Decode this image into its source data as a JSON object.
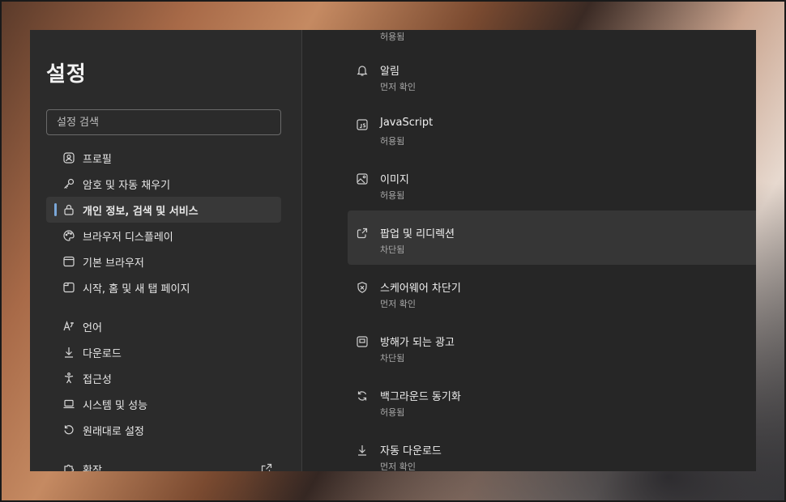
{
  "sidebar": {
    "title": "설정",
    "search_placeholder": "설정 검색",
    "items": [
      {
        "label": "프로필",
        "icon": "profile-icon"
      },
      {
        "label": "암호 및 자동 채우기",
        "icon": "key-icon"
      },
      {
        "label": "개인 정보, 검색 및 서비스",
        "icon": "lock-icon",
        "active": true
      },
      {
        "label": "브라우저 디스플레이",
        "icon": "palette-icon"
      },
      {
        "label": "기본 브라우저",
        "icon": "browser-icon"
      },
      {
        "label": "시작, 홈 및 새 탭 페이지",
        "icon": "home-tab-icon"
      },
      {
        "label": "언어",
        "icon": "language-icon"
      },
      {
        "label": "다운로드",
        "icon": "download-icon"
      },
      {
        "label": "접근성",
        "icon": "accessibility-icon"
      },
      {
        "label": "시스템 및 성능",
        "icon": "laptop-icon"
      },
      {
        "label": "원래대로 설정",
        "icon": "reset-icon"
      },
      {
        "label": "확장",
        "icon": "puzzle-icon"
      }
    ]
  },
  "content": {
    "top_status": "허용됨",
    "permissions": [
      {
        "name": "알림",
        "status": "먼저 확인",
        "icon": "bell-icon"
      },
      {
        "name": "JavaScript",
        "status": "허용됨",
        "icon": "javascript-icon"
      },
      {
        "name": "이미지",
        "status": "허용됨",
        "icon": "image-icon"
      },
      {
        "name": "팝업 및 리디렉션",
        "status": "차단됨",
        "icon": "popup-icon",
        "highlight": true
      },
      {
        "name": "스케어웨어 차단기",
        "status": "먼저 확인",
        "icon": "shield-icon"
      },
      {
        "name": "방해가 되는 광고",
        "status": "차단됨",
        "icon": "ad-icon"
      },
      {
        "name": "백그라운드 동기화",
        "status": "허용됨",
        "icon": "sync-icon"
      },
      {
        "name": "자동 다운로드",
        "status": "먼저 확인",
        "icon": "download-icon"
      }
    ]
  },
  "colors": {
    "accent": "#7aa7d8",
    "window_bg": "#2b2b2b",
    "content_bg": "#262626",
    "highlight_bg": "#363636"
  }
}
